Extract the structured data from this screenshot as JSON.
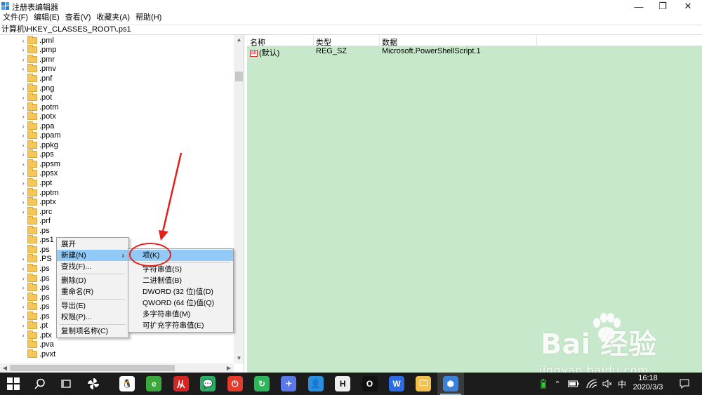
{
  "window": {
    "title": "注册表编辑器",
    "controls": {
      "minimize": "—",
      "maximize": "❐",
      "close": "✕"
    }
  },
  "menubar": [
    "文件(F)",
    "编辑(E)",
    "查看(V)",
    "收藏夹(A)",
    "帮助(H)"
  ],
  "address": "计算机\\HKEY_CLASSES_ROOT\\.ps1",
  "tree": {
    "items": [
      ".pml",
      ".pmp",
      ".pmr",
      ".pmv",
      ".pnf",
      ".png",
      ".pot",
      ".potm",
      ".potx",
      ".ppa",
      ".ppam",
      ".ppkg",
      ".pps",
      ".ppsm",
      ".ppsx",
      ".ppt",
      ".pptm",
      ".pptx",
      ".prc",
      ".prf",
      ".ps",
      ".ps1",
      ".ps",
      ".PS",
      ".ps",
      ".ps",
      ".ps",
      ".ps",
      ".ps",
      ".ps",
      ".pt",
      ".ptx",
      ".pva",
      ".pvxt"
    ],
    "expandable": [
      true,
      true,
      true,
      true,
      false,
      true,
      true,
      true,
      true,
      true,
      true,
      true,
      true,
      true,
      true,
      true,
      true,
      true,
      true,
      false,
      false,
      false,
      false,
      true,
      true,
      true,
      true,
      true,
      true,
      true,
      true,
      true,
      false,
      false
    ]
  },
  "values": {
    "columns": [
      "名称",
      "类型",
      "数据"
    ],
    "rows": [
      {
        "name": "(默认)",
        "type": "REG_SZ",
        "data": "Microsoft.PowerShellScript.1",
        "icon": "ab"
      }
    ]
  },
  "context_menu": {
    "items": [
      "展开",
      "新建(N)",
      "查找(F)...",
      "删除(D)",
      "重命名(R)",
      "导出(E)",
      "权限(P)...",
      "复制项名称(C)"
    ],
    "submenu_arrow": "›"
  },
  "new_submenu": {
    "items": [
      "项(K)",
      "字符串值(S)",
      "二进制值(B)",
      "DWORD (32 位)值(D)",
      "QWORD (64 位)值(Q)",
      "多字符串值(M)",
      "可扩充字符串值(E)"
    ]
  },
  "watermark": {
    "main": "Bai  经验",
    "sub": "jingyan.baidu.com"
  },
  "taskbar": {
    "apps": [
      {
        "name": "qq",
        "color": "#ffffff",
        "glyph": "🐧"
      },
      {
        "name": "browser",
        "color": "#3aa83a",
        "glyph": "e"
      },
      {
        "name": "app-red",
        "color": "#d42424",
        "glyph": "从"
      },
      {
        "name": "wechat",
        "color": "#2aae67",
        "glyph": "💬"
      },
      {
        "name": "power",
        "color": "#e53b2c",
        "glyph": "⏻"
      },
      {
        "name": "refresh",
        "color": "#2fb65a",
        "glyph": "↻"
      },
      {
        "name": "feishu",
        "color": "#5a79e8",
        "glyph": "✈"
      },
      {
        "name": "qq-blue",
        "color": "#2b8fe0",
        "glyph": "👤"
      },
      {
        "name": "h-app",
        "color": "#eeeeee",
        "glyph": "H"
      },
      {
        "name": "o-app",
        "color": "#111111",
        "glyph": "O"
      },
      {
        "name": "wps",
        "color": "#2c6be5",
        "glyph": "W"
      },
      {
        "name": "explorer",
        "color": "#f2c14e",
        "glyph": "🗀"
      },
      {
        "name": "regedit",
        "color": "#3b82d6",
        "glyph": "⬢"
      }
    ],
    "tray": {
      "ime": "中",
      "time": "16:18",
      "date": "2020/3/3"
    }
  }
}
